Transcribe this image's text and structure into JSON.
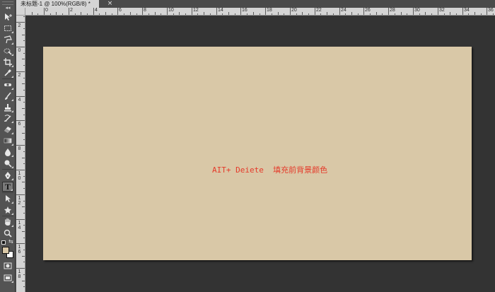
{
  "toolbox": {
    "collapse_label": "◂◂",
    "active_tool": "type-tool",
    "tools": [
      {
        "name": "move-tool",
        "icon": "move-icon"
      },
      {
        "name": "marquee-tool",
        "icon": "rectangular-marquee-icon"
      },
      {
        "name": "lasso-tool",
        "icon": "polygonal-lasso-icon"
      },
      {
        "name": "quick-selection-tool",
        "icon": "quick-selection-icon"
      },
      {
        "name": "crop-tool",
        "icon": "crop-icon"
      },
      {
        "name": "eyedropper-tool",
        "icon": "eyedropper-icon"
      },
      {
        "name": "spot-healing-tool",
        "icon": "spot-healing-brush-icon"
      },
      {
        "name": "brush-tool",
        "icon": "brush-icon"
      },
      {
        "name": "clone-stamp-tool",
        "icon": "clone-stamp-icon"
      },
      {
        "name": "history-brush-tool",
        "icon": "history-brush-icon"
      },
      {
        "name": "eraser-tool",
        "icon": "eraser-icon"
      },
      {
        "name": "gradient-tool",
        "icon": "gradient-icon"
      },
      {
        "name": "blur-tool",
        "icon": "blur-icon"
      },
      {
        "name": "dodge-tool",
        "icon": "dodge-icon"
      },
      {
        "name": "pen-tool",
        "icon": "pen-icon"
      },
      {
        "name": "type-tool",
        "icon": "type-icon",
        "glyph": "T"
      },
      {
        "name": "path-selection-tool",
        "icon": "path-selection-icon"
      },
      {
        "name": "shape-tool",
        "icon": "custom-shape-icon"
      },
      {
        "name": "hand-tool",
        "icon": "hand-icon"
      },
      {
        "name": "zoom-tool",
        "icon": "zoom-icon"
      }
    ],
    "foreground_color": "#d9c8a7",
    "background_color": "#ffffff"
  },
  "document_tab": {
    "title": "未标题-1 @ 100%(RGB/8) *",
    "close_glyph": "×"
  },
  "rulers": {
    "top_labels": [
      "0",
      "2",
      "4",
      "6",
      "8",
      "10",
      "12",
      "14",
      "16",
      "18",
      "20",
      "22",
      "24",
      "26",
      "28",
      "30",
      "32",
      "34",
      "36"
    ],
    "left_labels": [
      "2",
      "0",
      "2",
      "4",
      "6",
      "8",
      "10",
      "12",
      "14",
      "16",
      "18"
    ]
  },
  "canvas": {
    "background_color": "#d9c8a7",
    "text": "AIT+ Deiete  填充前背景颜色",
    "text_color": "#e53a2a"
  },
  "workspace": {
    "pasteboard_color": "#333333"
  }
}
